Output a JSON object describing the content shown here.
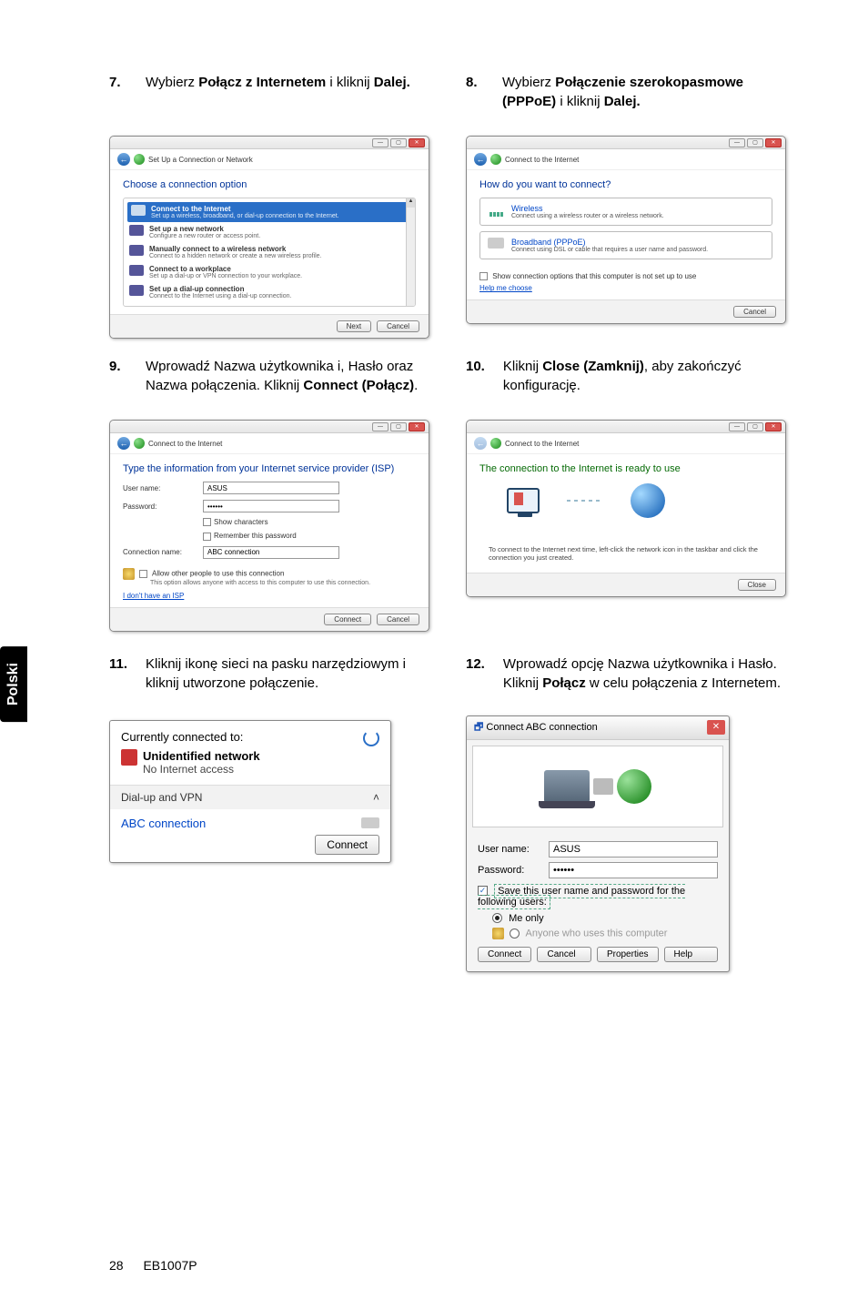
{
  "sideTab": "Polski",
  "footer": {
    "pageNum": "28",
    "model": "EB1007P"
  },
  "step7": {
    "num": "7.",
    "text_a": "Wybierz ",
    "bold_a": "Połącz z Internetem",
    "text_b": " i kliknij ",
    "bold_b": "Dalej."
  },
  "step8": {
    "num": "8.",
    "text_a": "Wybierz ",
    "bold_a": "Połączenie szerokopasmowe (PPPoE)",
    "text_b": "  i kliknij ",
    "bold_b": "Dalej."
  },
  "step9": {
    "num": "9.",
    "text_a": "Wprowadź Nazwa użytkownika i, Hasło oraz Nazwa połączenia. Kliknij ",
    "bold_a": "Connect (Połącz)",
    "text_b": "."
  },
  "step10": {
    "num": "10.",
    "text_a": "Kliknij ",
    "bold_a": "Close (Zamknij)",
    "text_b": ", aby zakończyć konfigurację."
  },
  "step11": {
    "num": "11.",
    "text_a": "Kliknij ikonę sieci na pasku narzędziowym i kliknij utworzone połączenie."
  },
  "step12": {
    "num": "12.",
    "text_a": "Wprowadź opcję Nazwa użytkownika i Hasło. Kliknij ",
    "bold_a": "Połącz",
    "text_b": " w celu połączenia z Internetem."
  },
  "dlg7": {
    "title": "Set Up a Connection or Network",
    "heading": "Choose a connection option",
    "opts": [
      {
        "t1": "Connect to the Internet",
        "t2": "Set up a wireless, broadband, or dial-up connection to the Internet."
      },
      {
        "t1": "Set up a new network",
        "t2": "Configure a new router or access point."
      },
      {
        "t1": "Manually connect to a wireless network",
        "t2": "Connect to a hidden network or create a new wireless profile."
      },
      {
        "t1": "Connect to a workplace",
        "t2": "Set up a dial-up or VPN connection to your workplace."
      },
      {
        "t1": "Set up a dial-up connection",
        "t2": "Connect to the Internet using a dial-up connection."
      }
    ],
    "btnNext": "Next",
    "btnCancel": "Cancel"
  },
  "dlg8": {
    "title": "Connect to the Internet",
    "heading": "How do you want to connect?",
    "optWifiT": "Wireless",
    "optWifiD": "Connect using a wireless router or a wireless network.",
    "optBbT": "Broadband (PPPoE)",
    "optBbD": "Connect using DSL or cable that requires a user name and password.",
    "showOpts": "Show connection options that this computer is not set up to use",
    "help": "Help me choose",
    "btnCancel": "Cancel"
  },
  "dlg9": {
    "title": "Connect to the Internet",
    "heading": "Type the information from your Internet service provider (ISP)",
    "lblUser": "User name:",
    "valUser": "ASUS",
    "lblPass": "Password:",
    "valPass": "••••••",
    "chkShow": "Show characters",
    "chkRem": "Remember this password",
    "lblConn": "Connection name:",
    "valConn": "ABC connection",
    "chkAllow": "Allow other people to use this connection",
    "allowDesc": "This option allows anyone with access to this computer to use this connection.",
    "noIsp": "I don't have an ISP",
    "btnConnect": "Connect",
    "btnCancel": "Cancel"
  },
  "dlg10": {
    "title": "Connect to the Internet",
    "heading": "The connection to the Internet is ready to use",
    "note": "To connect to the Internet next time, left-click the network icon in the taskbar and click the connection you just created.",
    "btnClose": "Close"
  },
  "dlg11": {
    "head": "Currently connected to:",
    "netName": "Unidentified network",
    "netSub": "No Internet access",
    "section": "Dial-up and VPN",
    "item": "ABC connection",
    "btnConnect": "Connect"
  },
  "dlg12": {
    "titlePrefix": "Connect ",
    "titleName": "ABC connection",
    "lblUser": "User name:",
    "valUser": "ASUS",
    "lblPass": "Password:",
    "valPass": "••••••",
    "chkSave": "Save this user name and password for the following users:",
    "radioMe": "Me only",
    "radioAny": "Anyone who uses this computer",
    "btnConnect": "Connect",
    "btnCancel": "Cancel",
    "btnProps": "Properties",
    "btnHelp": "Help"
  }
}
